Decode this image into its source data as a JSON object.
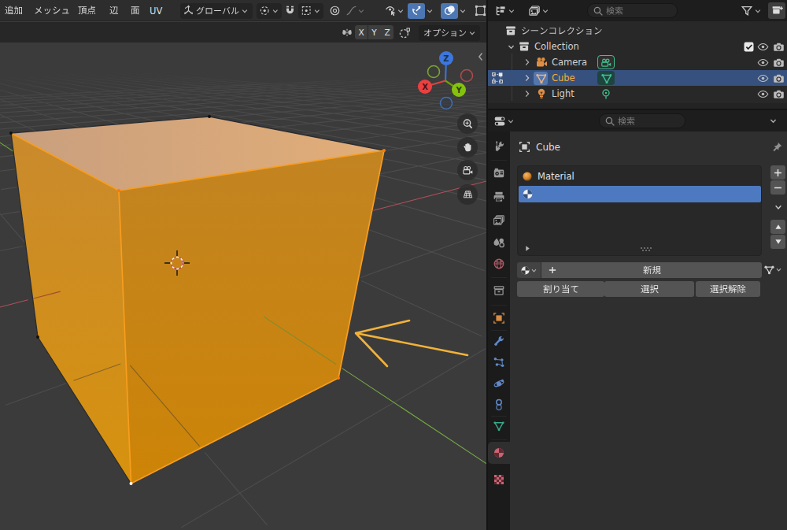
{
  "viewport": {
    "menus": [
      {
        "id": "add",
        "label": "追加"
      },
      {
        "id": "mesh",
        "label": "メッシュ"
      },
      {
        "id": "vertex",
        "label": "頂点"
      },
      {
        "id": "edge",
        "label": "辺"
      },
      {
        "id": "face",
        "label": "面"
      },
      {
        "id": "uv",
        "label": "UV"
      }
    ],
    "transform_orientation": "グローバル",
    "options_label": "オプション",
    "mirror_axes": [
      "X",
      "Y",
      "Z"
    ],
    "gizmo_axis_labels": {
      "x": "X",
      "y": "Y",
      "z": "Z"
    }
  },
  "outliner": {
    "search_placeholder": "検索",
    "rows": [
      {
        "label": "シーンコレクション",
        "type": "scene-collection"
      },
      {
        "label": "Collection",
        "type": "collection"
      },
      {
        "label": "Camera",
        "type": "camera"
      },
      {
        "label": "Cube",
        "type": "mesh",
        "selected": true
      },
      {
        "label": "Light",
        "type": "light"
      }
    ]
  },
  "properties": {
    "search_placeholder": "検索",
    "breadcrumb_object": "Cube",
    "material_slot_name": "Material",
    "new_material_label": "新規",
    "assign_label": "割り当て",
    "select_label": "選択",
    "deselect_label": "選択解除",
    "tabs": [
      "tool",
      "render",
      "output",
      "view-layer",
      "scene",
      "world",
      "collection",
      "object",
      "modifiers",
      "particles",
      "physics",
      "constraints",
      "object-data",
      "material",
      "texture"
    ],
    "active_tab": "material"
  },
  "colors": {
    "selection_blue": "#4d79c0",
    "object_orange": "#e0883a",
    "cube_face": "#d18a18",
    "annotation_yellow": "#f2b239",
    "axis_x_red": "#a2434d",
    "axis_y_green": "#679c40"
  }
}
